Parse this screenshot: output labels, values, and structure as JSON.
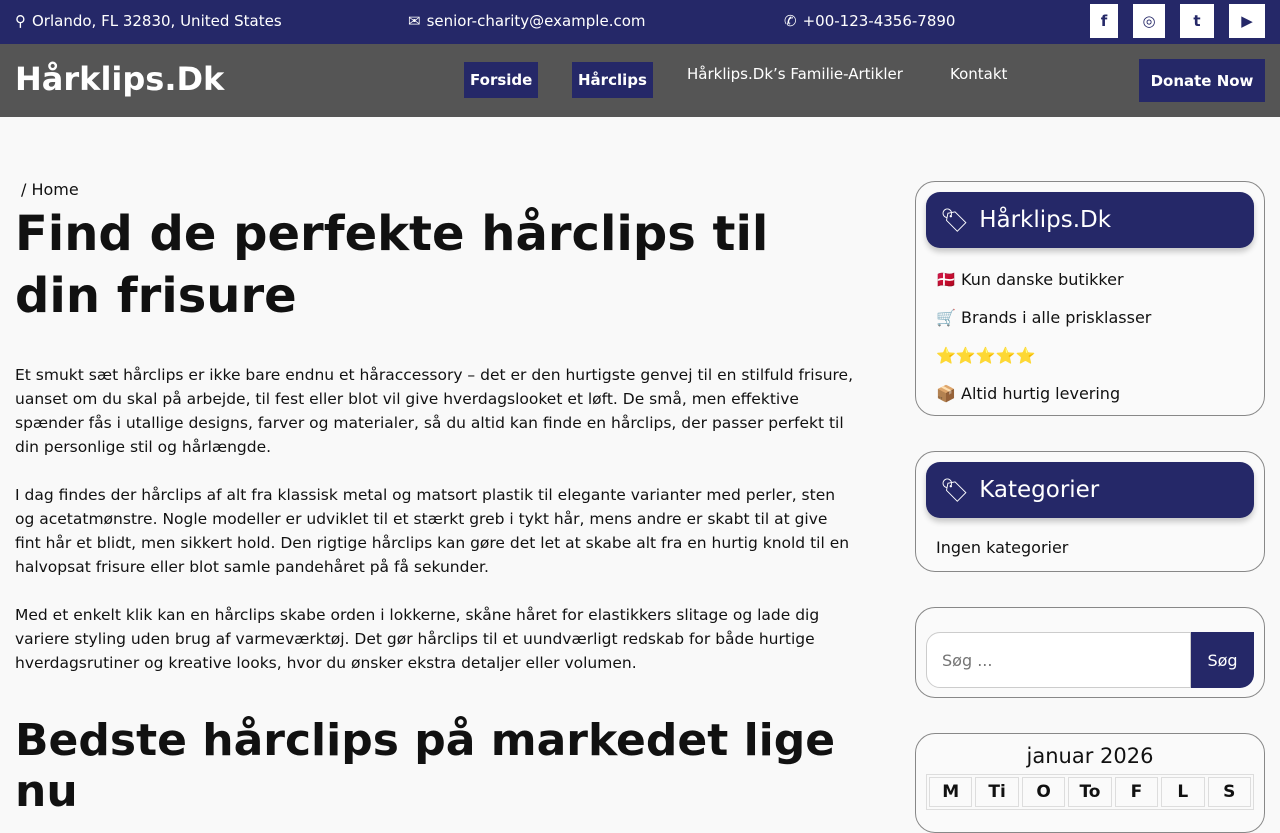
{
  "topbar": {
    "address": "Orlando, FL 32830, United States",
    "email": "senior-charity@example.com",
    "phone": "+00-123-4356-7890",
    "social": [
      "f",
      "◎",
      "t",
      "▶"
    ]
  },
  "nav": {
    "logo": "Hårklips.Dk",
    "items": [
      "Forside",
      "Hårclips",
      "Hårklips.Dk’s Familie-Artikler",
      "Kontakt"
    ],
    "donate": "Donate Now"
  },
  "main": {
    "breadcrumb_sep": "/",
    "breadcrumb": "Home",
    "title": "Find de perfekte hårclips til din frisure",
    "paragraphs": [
      "Et smukt sæt hårclips er ikke bare endnu et håraccessory – det er den hurtigste genvej til en stilfuld frisure, uanset om du skal på arbejde, til fest eller blot vil give hverdagslooket et løft. De små, men effektive spænder fås i utallige designs, farver og materialer, så du altid kan finde en hårclips, der passer perfekt til din personlige stil og hårlængde.",
      "I dag findes der hårclips af alt fra klassisk metal og matsort plastik til elegante varianter med perler, sten og acetatmønstre. Nogle modeller er udviklet til et stærkt greb i tykt hår, mens andre er skabt til at give fint hår et blidt, men sikkert hold. Den rigtige hårclips kan gøre det let at skabe alt fra en hurtig knold til en halvopsat frisure eller blot samle pandehåret på få sekunder.",
      "Med et enkelt klik kan en hårclips skabe orden i lokkerne, skåne håret for elastikkers slitage og lade dig variere styling uden brug af varmeværktøj. Det gør hårclips til et uundværligt redskab for både hurtige hverdagsrutiner og kreative looks, hvor du ønsker ekstra detaljer eller volumen."
    ],
    "subtitle": "Bedste hårclips på markedet lige nu"
  },
  "sidebar": {
    "brand_title": "Hårklips.Dk",
    "brand_items": [
      "🇩🇰 Kun danske butikker",
      "🛒 Brands i alle prisklasser",
      "⭐⭐⭐⭐⭐",
      "📦 Altid hurtig levering"
    ],
    "cat_title": "Kategorier",
    "cat_empty": "Ingen kategorier",
    "search_placeholder": "Søg ...",
    "search_button": "Søg",
    "calendar_title": "januar 2026",
    "weekdays": [
      "M",
      "Ti",
      "O",
      "To",
      "F",
      "L",
      "S"
    ]
  },
  "colors": {
    "primary": "#252868",
    "nav": "#555555"
  }
}
